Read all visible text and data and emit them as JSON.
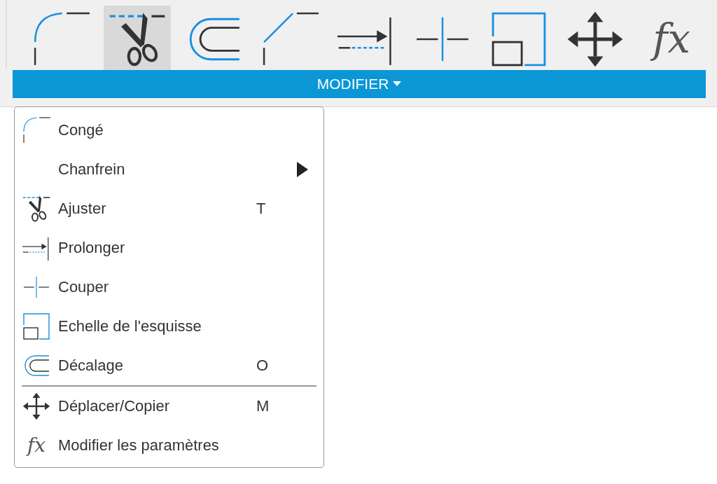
{
  "toolbar": {
    "tools": [
      {
        "kind": "fillet",
        "selected": false
      },
      {
        "kind": "trim",
        "selected": true
      },
      {
        "kind": "offset",
        "selected": false
      },
      {
        "kind": "chamfer",
        "selected": false
      },
      {
        "kind": "extend",
        "selected": false
      },
      {
        "kind": "break",
        "selected": false
      },
      {
        "kind": "scale",
        "selected": false
      },
      {
        "kind": "move",
        "selected": false
      },
      {
        "kind": "formula",
        "glyph": "fx",
        "selected": false
      }
    ],
    "panel_label": "MODIFIER"
  },
  "menu": {
    "items": [
      {
        "kind": "fillet",
        "label": "Congé"
      },
      {
        "kind": "submenu",
        "label": "Chanfrein"
      },
      {
        "kind": "trim",
        "label": "Ajuster",
        "shortcut": "T"
      },
      {
        "kind": "extend",
        "label": "Prolonger"
      },
      {
        "kind": "break",
        "label": "Couper"
      },
      {
        "kind": "scale",
        "label": "Echelle de l'esquisse"
      },
      {
        "kind": "offset",
        "label": "Décalage",
        "shortcut": "O"
      },
      {
        "kind": "separator"
      },
      {
        "kind": "move",
        "label": "Déplacer/Copier",
        "shortcut": "M"
      },
      {
        "kind": "formula",
        "glyph": "fx",
        "label": "Modifier les paramètres"
      }
    ]
  }
}
